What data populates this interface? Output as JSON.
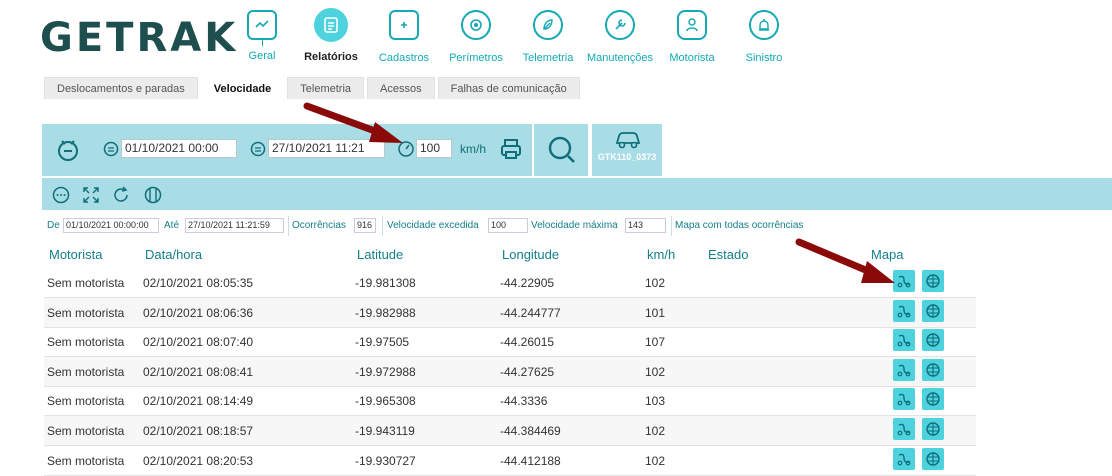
{
  "app": {
    "logo": "GETRAK"
  },
  "nav": {
    "items": [
      {
        "label": "Geral",
        "icon": "monitor-icon"
      },
      {
        "label": "Relatórios",
        "icon": "reports-icon",
        "active": true
      },
      {
        "label": "Cadastros",
        "icon": "folder-add-icon"
      },
      {
        "label": "Perímetros",
        "icon": "target-icon"
      },
      {
        "label": "Telemetria",
        "icon": "leaf-icon"
      },
      {
        "label": "Manutenções",
        "icon": "wrench-icon"
      },
      {
        "label": "Motorista",
        "icon": "driver-icon"
      },
      {
        "label": "Sinistro",
        "icon": "alarm-icon"
      }
    ]
  },
  "tabs": [
    {
      "label": "Deslocamentos e paradas"
    },
    {
      "label": "Velocidade",
      "active": true
    },
    {
      "label": "Telemetria"
    },
    {
      "label": "Acessos"
    },
    {
      "label": "Falhas de comunicação"
    }
  ],
  "filters": {
    "start_date": "01/10/2021 00:00",
    "end_date": "27/10/2021 11:21",
    "speed_limit": "100",
    "speed_unit": "km/h",
    "vehicle": "GTK110_0373"
  },
  "summary": {
    "from_label": "De",
    "from_value": "01/10/2021 00:00:00",
    "to_label": "Até",
    "to_value": "27/10/2021 11:21:59",
    "occurrences_label": "Ocorrências",
    "occurrences_value": "916",
    "exceeded_label": "Velocidade excedida",
    "exceeded_value": "100",
    "max_label": "Velocidade máxima",
    "max_value": "143",
    "map_all_label": "Mapa com todas ocorrências"
  },
  "table": {
    "headers": {
      "driver": "Motorista",
      "datetime": "Data/hora",
      "lat": "Latitude",
      "lon": "Longitude",
      "speed": "km/h",
      "state": "Estado",
      "map": "Mapa"
    },
    "rows": [
      {
        "driver": "Sem motorista",
        "datetime": "02/10/2021 08:05:35",
        "lat": "-19.981308",
        "lon": "-44.22905",
        "speed": "102"
      },
      {
        "driver": "Sem motorista",
        "datetime": "02/10/2021 08:06:36",
        "lat": "-19.982988",
        "lon": "-44.244777",
        "speed": "101"
      },
      {
        "driver": "Sem motorista",
        "datetime": "02/10/2021 08:07:40",
        "lat": "-19.97505",
        "lon": "-44.26015",
        "speed": "107"
      },
      {
        "driver": "Sem motorista",
        "datetime": "02/10/2021 08:08:41",
        "lat": "-19.972988",
        "lon": "-44.27625",
        "speed": "102"
      },
      {
        "driver": "Sem motorista",
        "datetime": "02/10/2021 08:14:49",
        "lat": "-19.965308",
        "lon": "-44.3336",
        "speed": "103"
      },
      {
        "driver": "Sem motorista",
        "datetime": "02/10/2021 08:18:57",
        "lat": "-19.943119",
        "lon": "-44.384469",
        "speed": "102"
      },
      {
        "driver": "Sem motorista",
        "datetime": "02/10/2021 08:20:53",
        "lat": "-19.930727",
        "lon": "-44.412188",
        "speed": "102"
      }
    ]
  },
  "colors": {
    "accent": "#14a9b5",
    "panel": "#a8dde6",
    "button": "#4ed3de",
    "arrow": "#8a0a0a"
  }
}
